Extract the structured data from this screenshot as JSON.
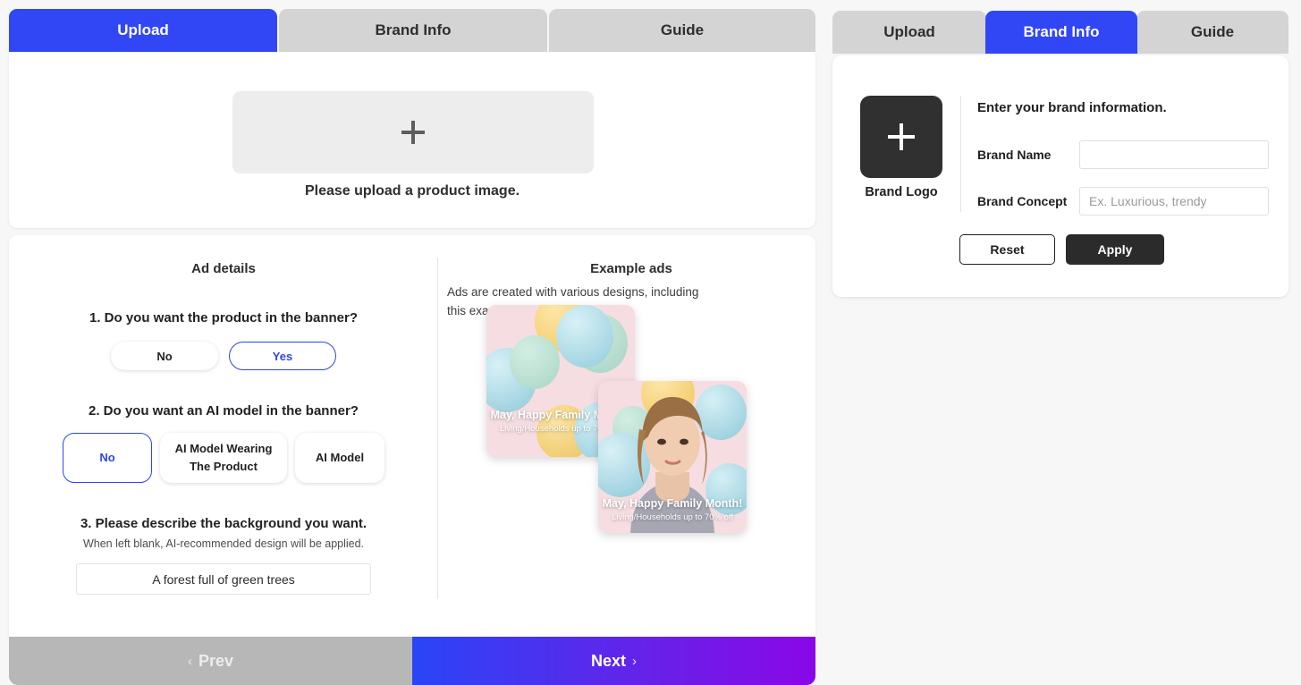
{
  "theme": {
    "accent_blue": "#3147f5",
    "tab_inactive": "#d4d4d4",
    "dark": "#2b2b2b",
    "page_bg": "#f7f7f7",
    "next_gradient_from": "#2a45f7",
    "next_gradient_to": "#8a07e8"
  },
  "left_panel": {
    "tabs": [
      {
        "label": "Upload",
        "active": true
      },
      {
        "label": "Brand Info",
        "active": false
      },
      {
        "label": "Guide",
        "active": false
      }
    ],
    "upload": {
      "dropzone_icon": "plus-icon",
      "hint": "Please upload a product image."
    },
    "ad_details": {
      "title": "Ad details",
      "questions": [
        {
          "text": "1. Do you want the product in the banner?",
          "options": [
            {
              "label": "No",
              "selected": false
            },
            {
              "label": "Yes",
              "selected": true
            }
          ]
        },
        {
          "text": "2. Do you want an AI model in the banner?",
          "options": [
            {
              "label": "No",
              "selected": true
            },
            {
              "label": "AI Model Wearing The Product",
              "selected": false
            },
            {
              "label": "AI Model",
              "selected": false
            }
          ]
        }
      ],
      "background_question": {
        "text": "3. Please describe the background you want.",
        "subtext": "When left blank, AI-recommended design will be applied.",
        "value": "A forest full of green trees",
        "placeholder": ""
      }
    },
    "example_ads": {
      "title": "Example ads",
      "subtitle": "Ads are created with various designs, including this example.",
      "cards": [
        {
          "headline": "May, Happy Family Month!",
          "subline": "Living/Households up to 70% off"
        },
        {
          "headline": "May, Happy Family Month!",
          "subline": "Living/Households up to 70% off"
        }
      ]
    },
    "nav": {
      "prev_label": "Prev",
      "prev_chevron": "chevron-left-icon",
      "next_label": "Next",
      "next_chevron": "chevron-right-icon"
    }
  },
  "right_panel": {
    "tabs": [
      {
        "label": "Upload",
        "active": false
      },
      {
        "label": "Brand Info",
        "active": true
      },
      {
        "label": "Guide",
        "active": false
      }
    ],
    "brand": {
      "logo_label": "Brand Logo",
      "logo_icon": "plus-icon",
      "heading": "Enter your brand information.",
      "name_label": "Brand Name",
      "name_value": "",
      "name_placeholder": "",
      "concept_label": "Brand Concept",
      "concept_value": "",
      "concept_placeholder": "Ex. Luxurious, trendy",
      "reset_label": "Reset",
      "apply_label": "Apply"
    }
  }
}
